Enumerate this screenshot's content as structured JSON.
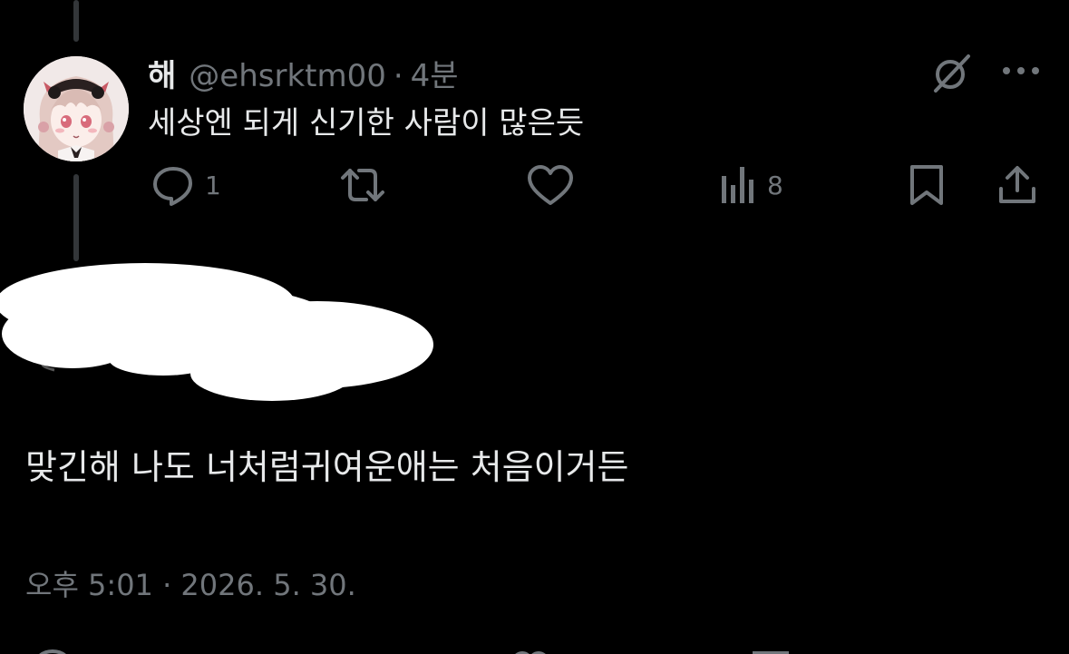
{
  "reply": {
    "display_name": "해",
    "handle": "@ehsrktm00",
    "separator": "·",
    "time_ago": "4분",
    "text": "세상엔 되게 신기한 사람이 많은듯"
  },
  "actions": {
    "reply_count": "1",
    "views_count": "8"
  },
  "main_post": {
    "text": "맞긴해 나도 너처럼귀여운애는 처음이거든",
    "timestamp": "오후 5:01 · 2026. 5. 30."
  },
  "colors": {
    "background": "#000000",
    "text_primary": "#e7e9ea",
    "text_secondary": "#71767b",
    "thread_line": "#333639",
    "redaction": "#ffffff"
  },
  "icons": {
    "reply": "reply-bubble-icon",
    "repost": "repost-icon",
    "like": "heart-icon",
    "views": "views-bar-chart-icon",
    "bookmark": "bookmark-icon",
    "share": "share-upload-icon",
    "grok": "grok-icon",
    "more": "more-dots-icon"
  }
}
